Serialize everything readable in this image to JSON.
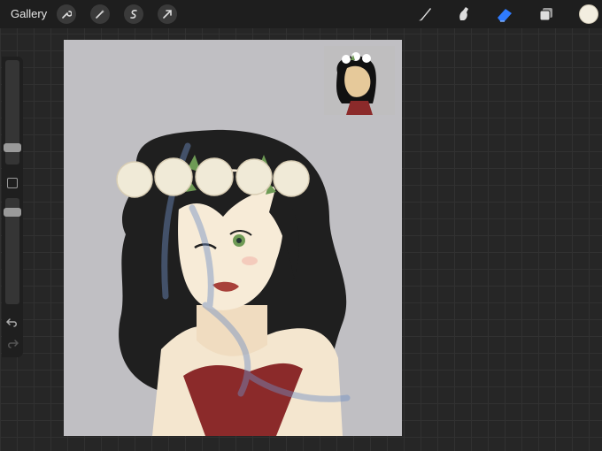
{
  "topbar": {
    "gallery_label": "Gallery",
    "left_tools": [
      {
        "name": "wrench-icon"
      },
      {
        "name": "magic-wand-icon"
      },
      {
        "name": "selection-icon"
      },
      {
        "name": "transform-arrow-icon"
      }
    ],
    "right_tools": [
      {
        "name": "brush-icon"
      },
      {
        "name": "smudge-icon"
      },
      {
        "name": "eraser-icon",
        "active_color": "#2f7bff"
      },
      {
        "name": "layers-icon"
      }
    ],
    "current_color": "#f3eee0"
  },
  "sidebar": {
    "brush_size": 0.3,
    "opacity": 0.95,
    "undo_icon": "undo-icon",
    "redo_icon": "redo-icon",
    "modify_icon": "square-icon"
  },
  "colors": {
    "background": "#262626",
    "canvas": "#c0bfc3",
    "hair": "#1f1f1f",
    "skin": "#f4e6cf",
    "dress": "#8b2a2a",
    "flower": "#f0ead7",
    "leaf": "#6e9a55"
  }
}
